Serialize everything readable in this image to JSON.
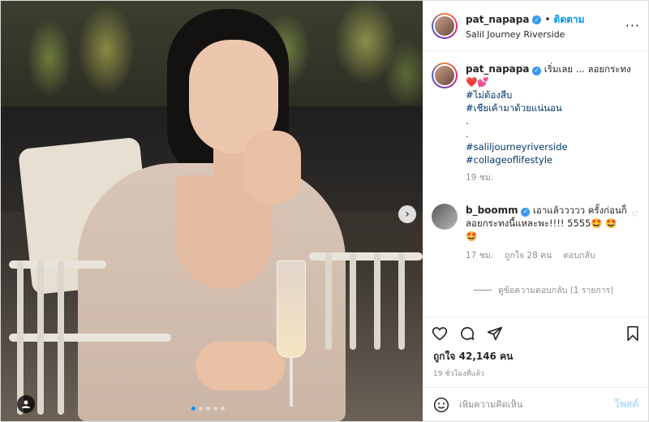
{
  "header": {
    "username": "pat_napapa",
    "follow_label": "ติดตาม",
    "separator": "•",
    "location": "Salil Journey Riverside"
  },
  "caption": {
    "username": "pat_napapa",
    "text": "เริ่มเลย ... ลอยกระทง",
    "emoji": "❤️💕",
    "hashtags": [
      "#ไม่ต้องสืบ",
      "#เชียเค้ามาด้วยแน่นอน"
    ],
    "dots": [
      ".",
      "."
    ],
    "hashtags2": [
      "#saliljourneyriverside",
      "#collageoflifestyle"
    ],
    "time": "19 ชม."
  },
  "comment": {
    "username": "b_boomm",
    "text": "เอาแล้ววววว ครั้งก่อนก็ลอยกระทงนี้แหละพะ!!!! 5555🤩 🤩🤩",
    "time": "17 ชม.",
    "likes": "ถูกใจ 28 คน",
    "reply": "ตอบกลับ"
  },
  "view_replies": "ดูข้อความตอบกลับ (1 รายการ)",
  "likes": "ถูกใจ 42,146 คน",
  "timestamp": "19 ชั่วโมงที่แล้ว",
  "add_comment": {
    "placeholder": "เพิ่มความคิดเห็น",
    "post_label": "โพสต์"
  },
  "icons": {
    "next": "›",
    "more": "···",
    "verified": "✓"
  }
}
